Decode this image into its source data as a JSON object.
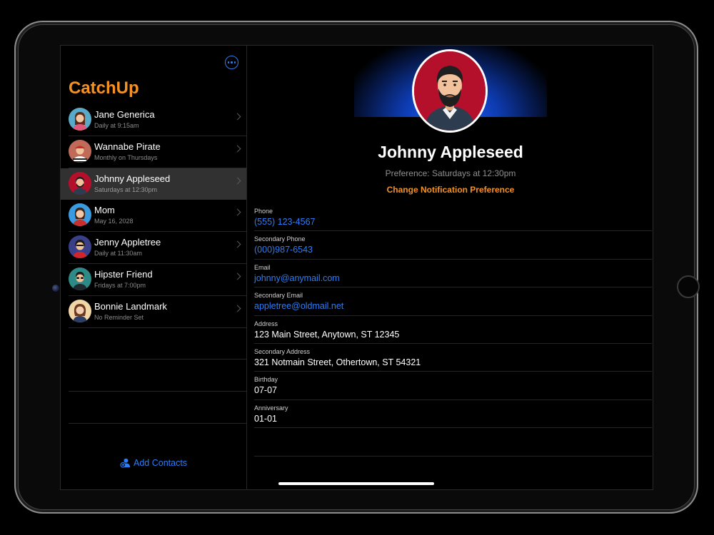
{
  "app": {
    "title": "CatchUp"
  },
  "sidebar": {
    "contacts": [
      {
        "name": "Jane Generica",
        "subtitle": "Daily at 9:15am"
      },
      {
        "name": "Wannabe Pirate",
        "subtitle": "Monthly on Thursdays"
      },
      {
        "name": "Johnny Appleseed",
        "subtitle": "Saturdays at 12:30pm",
        "selected": true
      },
      {
        "name": "Mom",
        "subtitle": "May 16, 2028"
      },
      {
        "name": "Jenny Appletree",
        "subtitle": "Daily at 11:30am"
      },
      {
        "name": "Hipster Friend",
        "subtitle": "Fridays at 7:00pm"
      },
      {
        "name": "Bonnie Landmark",
        "subtitle": "No Reminder Set"
      }
    ],
    "add_contacts_label": "Add Contacts"
  },
  "detail": {
    "name": "Johnny Appleseed",
    "preference": "Preference: Saturdays at 12:30pm",
    "change_preference_label": "Change Notification Preference",
    "fields": [
      {
        "label": "Phone",
        "value": "(555) 123-4567",
        "link": true
      },
      {
        "label": "Secondary Phone",
        "value": "(000)987-6543",
        "link": true
      },
      {
        "label": "Email",
        "value": "johnny@anymail.com",
        "link": true
      },
      {
        "label": "Secondary Email",
        "value": "appletree@oldmail.net",
        "link": true
      },
      {
        "label": "Address",
        "value": "123 Main Street, Anytown, ST 12345",
        "link": false
      },
      {
        "label": "Secondary Address",
        "value": "321 Notmain Street, Othertown, ST 54321",
        "link": false
      },
      {
        "label": "Birthday",
        "value": "07-07",
        "link": false
      },
      {
        "label": "Anniversary",
        "value": "01-01",
        "link": false
      }
    ]
  },
  "colors": {
    "accent": "#f39223",
    "link": "#2f7df6",
    "selected_row": "#313131",
    "avatar_red": "#b5102b"
  }
}
